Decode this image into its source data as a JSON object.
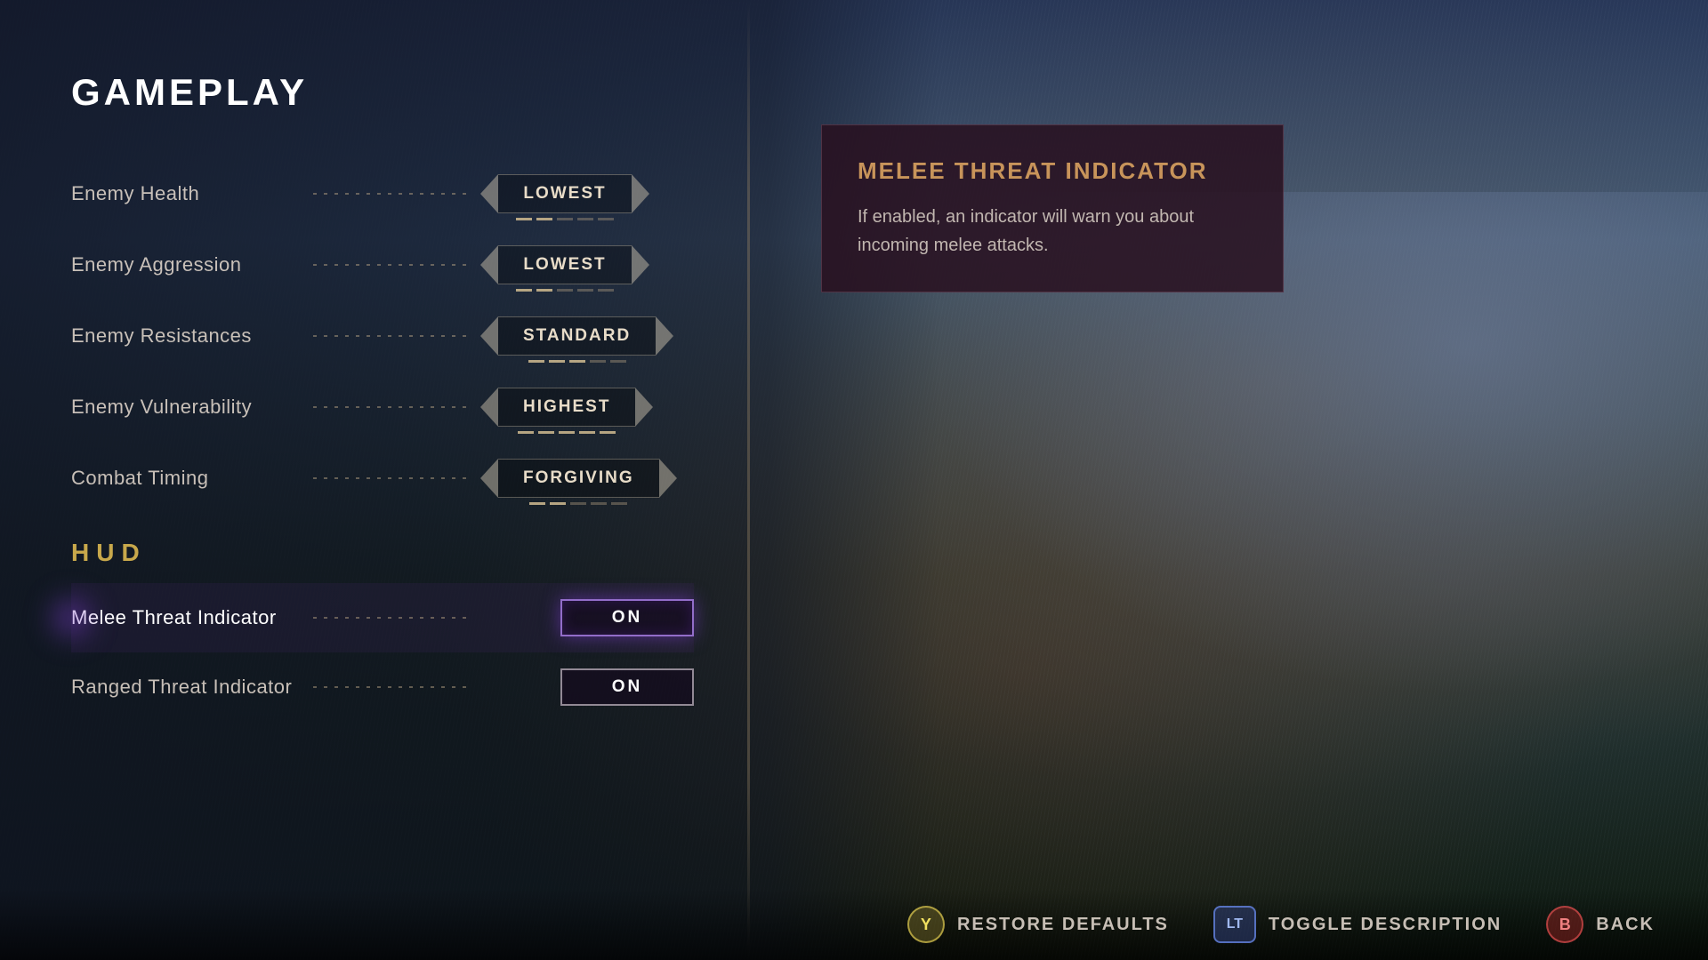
{
  "page": {
    "title": "GAMEPLAY"
  },
  "settings": {
    "combat_section": [
      {
        "label": "Enemy Health",
        "value": "LOWEST",
        "type": "range",
        "indicators": [
          true,
          true,
          false,
          false,
          false,
          false
        ]
      },
      {
        "label": "Enemy Aggression",
        "value": "LOWEST",
        "type": "range",
        "indicators": [
          true,
          true,
          false,
          false,
          false,
          false
        ]
      },
      {
        "label": "Enemy Resistances",
        "value": "STANDARD",
        "type": "range",
        "indicators": [
          true,
          true,
          true,
          false,
          false,
          false
        ]
      },
      {
        "label": "Enemy Vulnerability",
        "value": "HIGHEST",
        "type": "range",
        "indicators": [
          true,
          true,
          true,
          true,
          true,
          false
        ]
      },
      {
        "label": "Combat Timing",
        "value": "FORGIVING",
        "type": "range",
        "indicators": [
          true,
          true,
          false,
          false,
          false,
          false
        ]
      }
    ],
    "hud_section_label": "HUD",
    "hud_section": [
      {
        "label": "Melee Threat Indicator",
        "value": "ON",
        "type": "toggle",
        "active": true
      },
      {
        "label": "Ranged Threat Indicator",
        "value": "ON",
        "type": "toggle",
        "active": false
      }
    ]
  },
  "description": {
    "title": "MELEE THREAT INDICATOR",
    "text": "If enabled, an indicator will warn you about incoming melee attacks."
  },
  "bottom_actions": [
    {
      "icon_label": "Y",
      "icon_type": "y",
      "action_label": "RESTORE DEFAULTS"
    },
    {
      "icon_label": "LT",
      "icon_type": "lt",
      "action_label": "TOGGLE DESCRIPTION"
    },
    {
      "icon_label": "B",
      "icon_type": "b",
      "action_label": "BACK"
    }
  ]
}
